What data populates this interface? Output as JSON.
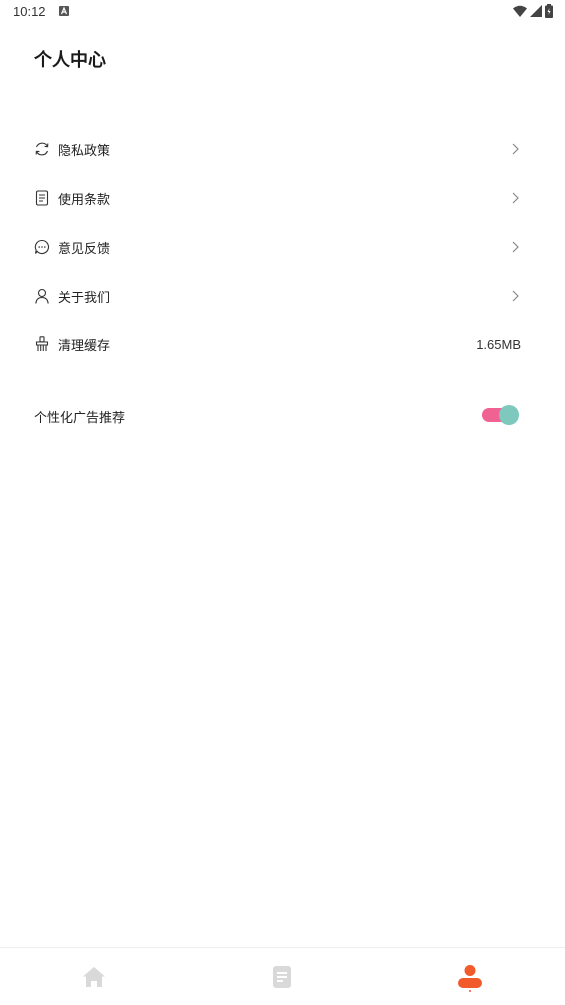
{
  "status_bar": {
    "time": "10:12"
  },
  "header": {
    "title": "个人中心"
  },
  "menu": {
    "items": [
      {
        "label": "隐私政策",
        "icon": "refresh-icon"
      },
      {
        "label": "使用条款",
        "icon": "document-icon"
      },
      {
        "label": "意见反馈",
        "icon": "chat-icon"
      },
      {
        "label": "关于我们",
        "icon": "person-icon"
      },
      {
        "label": "清理缓存",
        "icon": "broom-icon",
        "value": "1.65MB"
      }
    ]
  },
  "ad_setting": {
    "label": "个性化广告推荐",
    "enabled": true
  },
  "bottom_nav": {
    "items": [
      {
        "icon": "home-icon",
        "active": false
      },
      {
        "icon": "list-icon",
        "active": false
      },
      {
        "icon": "user-icon",
        "active": true
      }
    ]
  },
  "colors": {
    "accent": "#f15a2b",
    "toggle_track": "#f06292",
    "toggle_knob": "#7ec8bd",
    "inactive_icon": "#d9d9d9"
  }
}
